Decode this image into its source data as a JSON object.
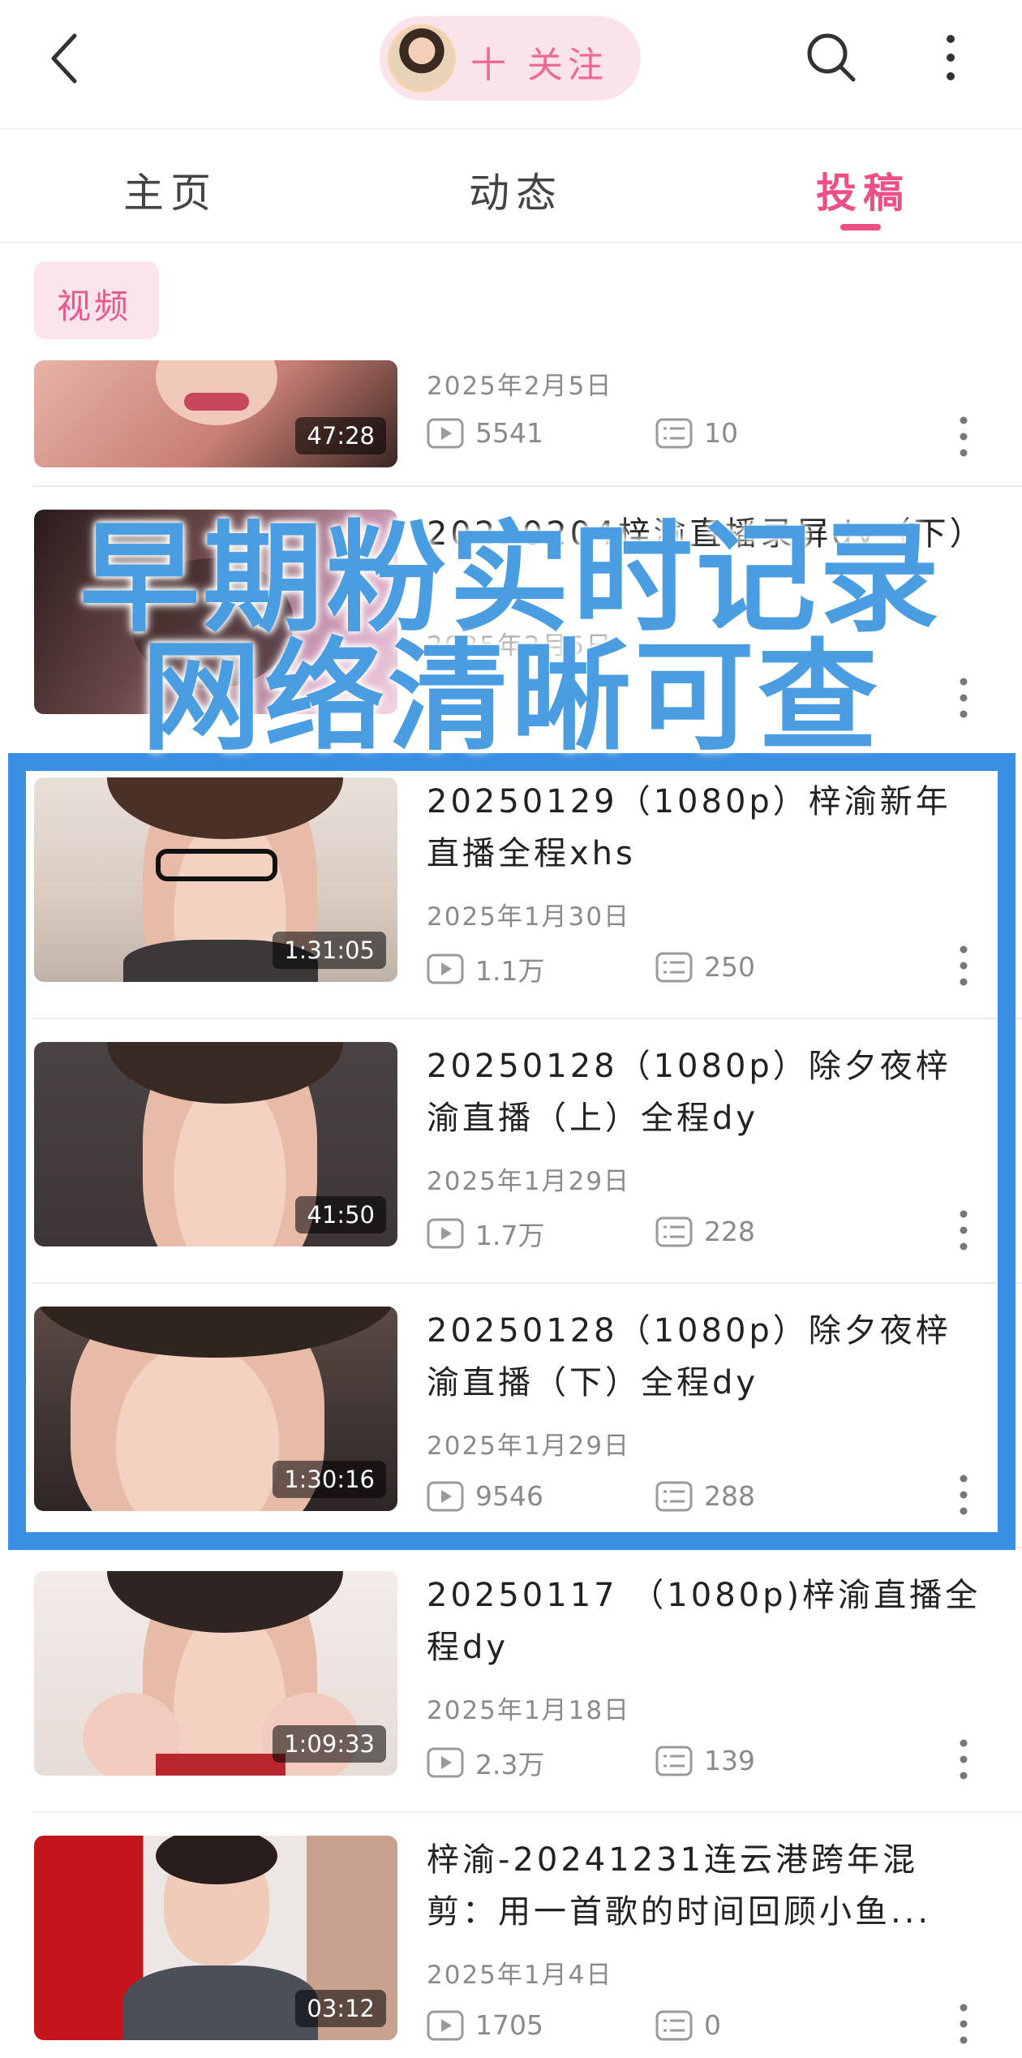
{
  "header": {
    "back_icon": "chevron-left-icon",
    "follow_label": "十 关注",
    "search_icon": "search-icon",
    "more_icon": "more-vertical-icon"
  },
  "tabs": [
    {
      "label": "主页",
      "active": false
    },
    {
      "label": "动态",
      "active": false
    },
    {
      "label": "投稿",
      "active": true
    }
  ],
  "filter_chip": {
    "label": "视频"
  },
  "overlay": {
    "line1": "早期粉实时记录",
    "line2": "网络清晰可查"
  },
  "colors": {
    "accent": "#ee4f86",
    "overlay_blue": "#4a9de0",
    "highlight_blue": "#3b8fe3"
  },
  "videos": [
    {
      "title": "",
      "date": "2025年2月5日",
      "duration": "47:28",
      "plays": "5541",
      "comments": "10"
    },
    {
      "title": "20250204梓渝直播录屏dy（下）",
      "date": "2025年2月5日",
      "duration": "",
      "plays": "",
      "comments": ""
    },
    {
      "title": "20250129（1080p）梓渝新年直播全程xhs",
      "date": "2025年1月30日",
      "duration": "1:31:05",
      "plays": "1.1万",
      "comments": "250"
    },
    {
      "title": "20250128（1080p）除夕夜梓渝直播（上）全程dy",
      "date": "2025年1月29日",
      "duration": "41:50",
      "plays": "1.7万",
      "comments": "228"
    },
    {
      "title": "20250128（1080p）除夕夜梓渝直播（下）全程dy",
      "date": "2025年1月29日",
      "duration": "1:30:16",
      "plays": "9546",
      "comments": "288"
    },
    {
      "title": "20250117 （1080p)梓渝直播全程dy",
      "date": "2025年1月18日",
      "duration": "1:09:33",
      "plays": "2.3万",
      "comments": "139"
    },
    {
      "title": "梓渝-20241231连云港跨年混剪：用一首歌的时间回顾小鱼...",
      "date": "2025年1月4日",
      "duration": "03:12",
      "plays": "1705",
      "comments": "0"
    }
  ]
}
